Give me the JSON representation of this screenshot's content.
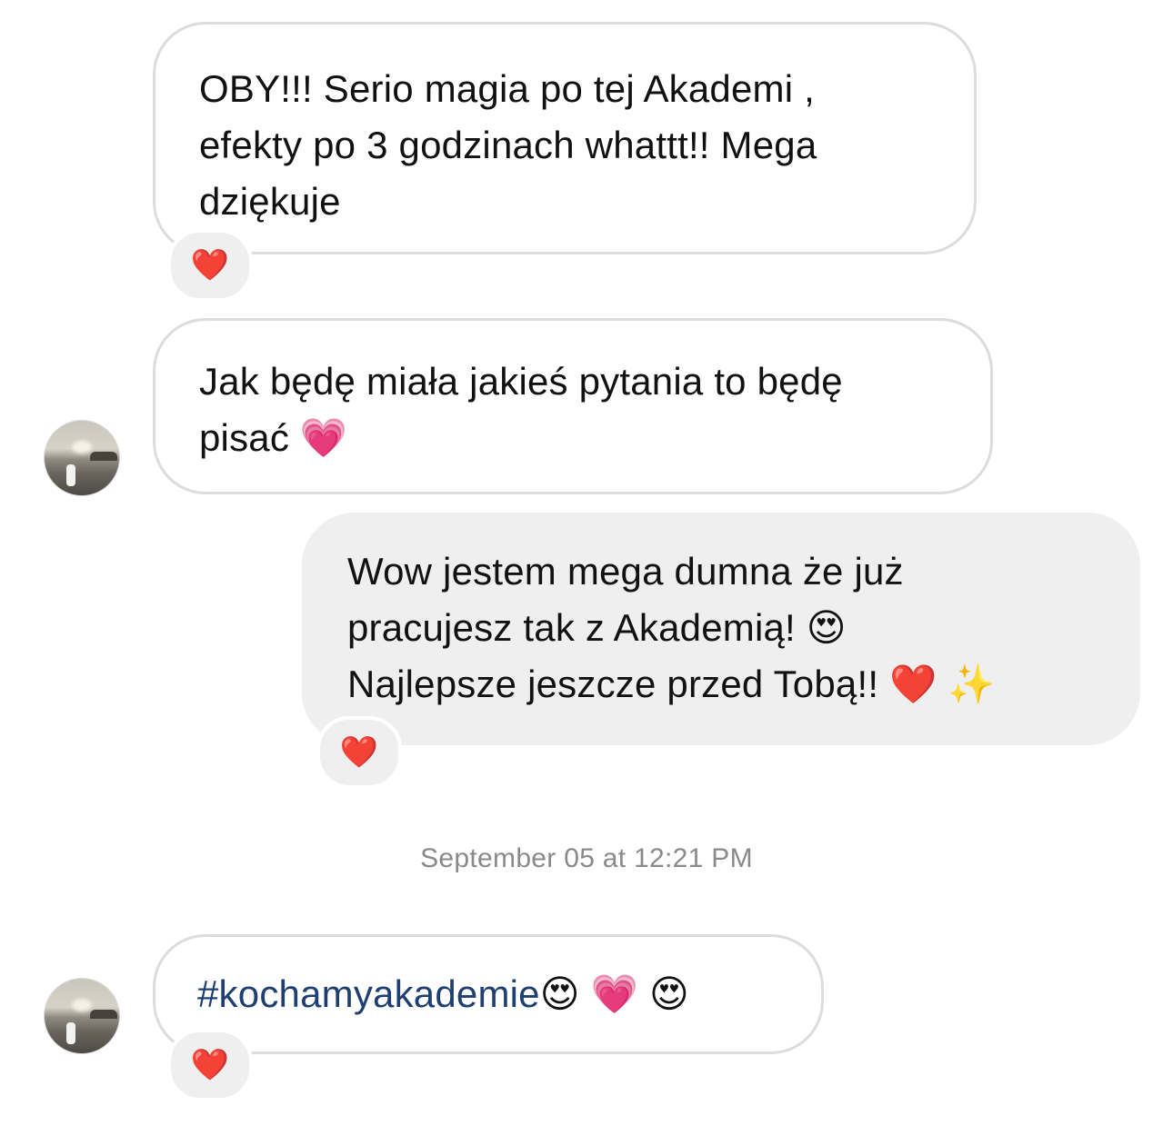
{
  "messages": [
    {
      "direction": "incoming",
      "lines": [
        "OBY!!! Serio magia po tej Akademi ,",
        "efekty po 3 godzinach whattt!! Mega",
        "dziękuje"
      ],
      "reaction": "❤️"
    },
    {
      "direction": "incoming",
      "lines": [
        "Jak będę miała jakieś pytania to będę",
        "pisać 💗"
      ]
    },
    {
      "direction": "outgoing",
      "lines": [
        "Wow jestem mega dumna że już",
        "pracujesz tak z Akademią! 😍",
        "Najlepsze jeszcze przed Tobą!! ❤️ ✨"
      ],
      "reaction": "❤️"
    },
    {
      "direction": "incoming",
      "hashtag": "#kochamyakademie",
      "emojis": "😍 💗 😍",
      "reaction": "❤️"
    }
  ],
  "timestamp": "September 05 at 12:21 PM"
}
